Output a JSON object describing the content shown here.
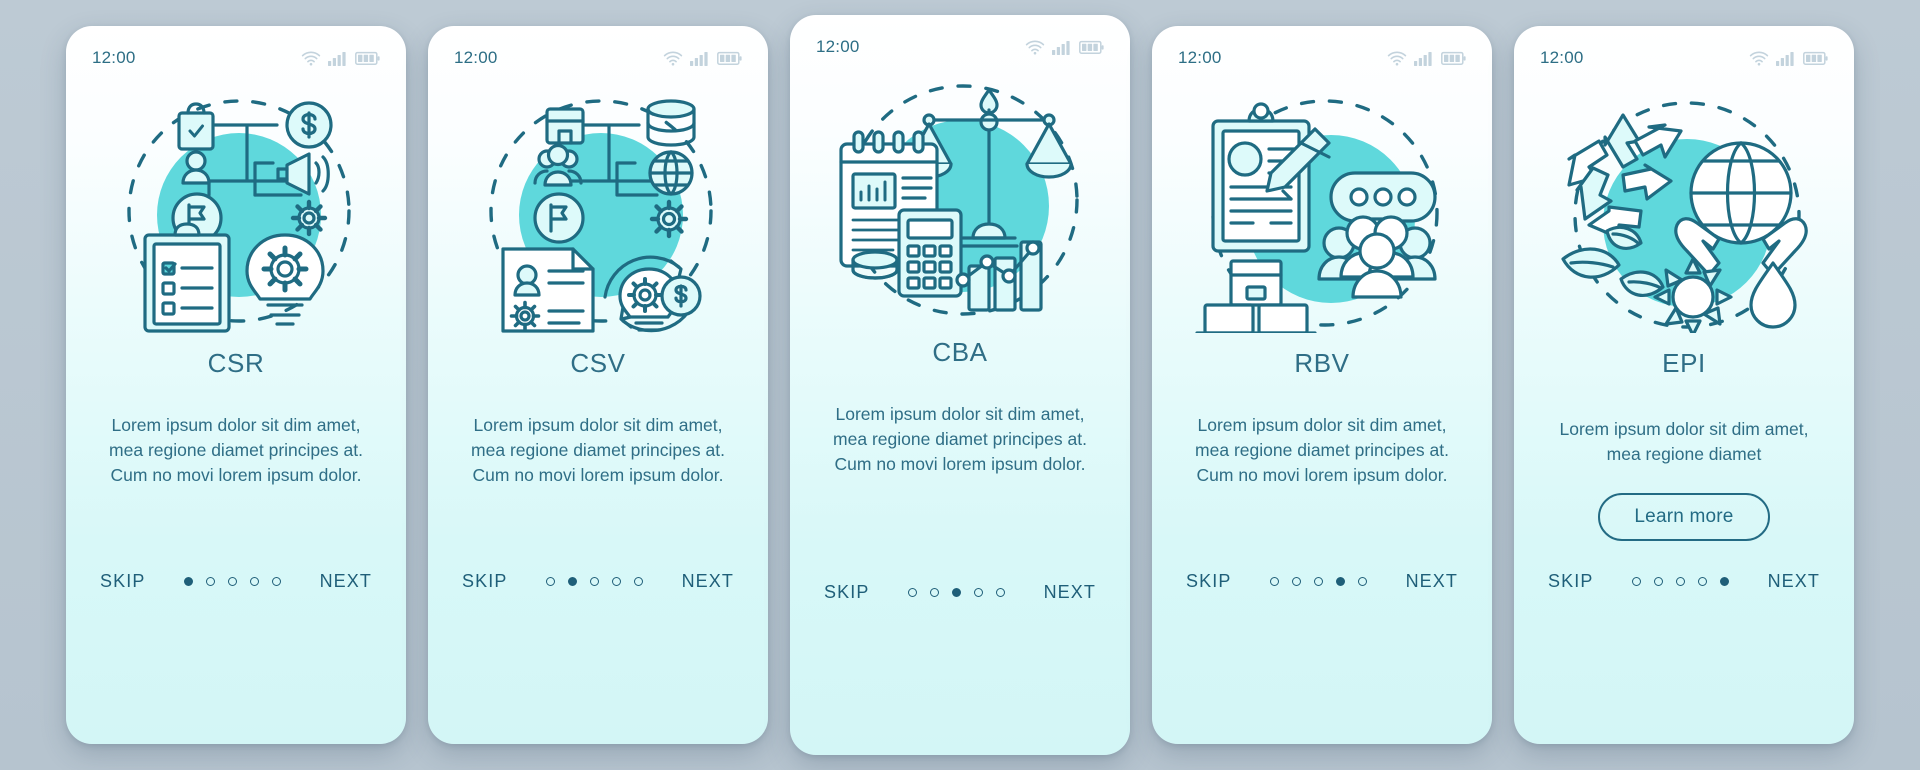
{
  "background_color": "#b9c7d2",
  "accent_color": "#5fd8dc",
  "line_color": "#1f6b82",
  "text_color": "#2f6e86",
  "status_bar": {
    "time": "12:00",
    "icons": [
      "wifi-icon",
      "cellular-signal-icon",
      "battery-icon"
    ]
  },
  "nav": {
    "skip_label": "SKIP",
    "next_label": "NEXT",
    "total_dots": 5
  },
  "screens": [
    {
      "id": "csr",
      "title": "CSR",
      "body": "Lorem ipsum dolor sit dim amet, mea regione diamet principes at. Cum no movi lorem ipsum dolor.",
      "active_dot": 1,
      "illustration": "csr-strategy-illustration",
      "has_learn_more": false,
      "learn_more_label": ""
    },
    {
      "id": "csv",
      "title": "CSV",
      "body": "Lorem ipsum dolor sit dim amet, mea regione diamet principes at. Cum no movi lorem ipsum dolor.",
      "active_dot": 2,
      "illustration": "csv-shared-value-illustration",
      "has_learn_more": false,
      "learn_more_label": ""
    },
    {
      "id": "cba",
      "title": "CBA",
      "body": "Lorem ipsum dolor sit dim amet, mea regione diamet principes at. Cum no movi lorem ipsum dolor.",
      "active_dot": 3,
      "illustration": "cba-cost-benefit-illustration",
      "has_learn_more": false,
      "learn_more_label": ""
    },
    {
      "id": "rbv",
      "title": "RBV",
      "body": "Lorem ipsum dolor sit dim amet, mea regione diamet principes at. Cum no movi lorem ipsum dolor.",
      "active_dot": 4,
      "illustration": "rbv-resources-illustration",
      "has_learn_more": false,
      "learn_more_label": ""
    },
    {
      "id": "epi",
      "title": "EPI",
      "body": "Lorem ipsum dolor sit dim amet, mea regione diamet",
      "active_dot": 5,
      "illustration": "epi-environment-illustration",
      "has_learn_more": true,
      "learn_more_label": "Learn more"
    }
  ]
}
